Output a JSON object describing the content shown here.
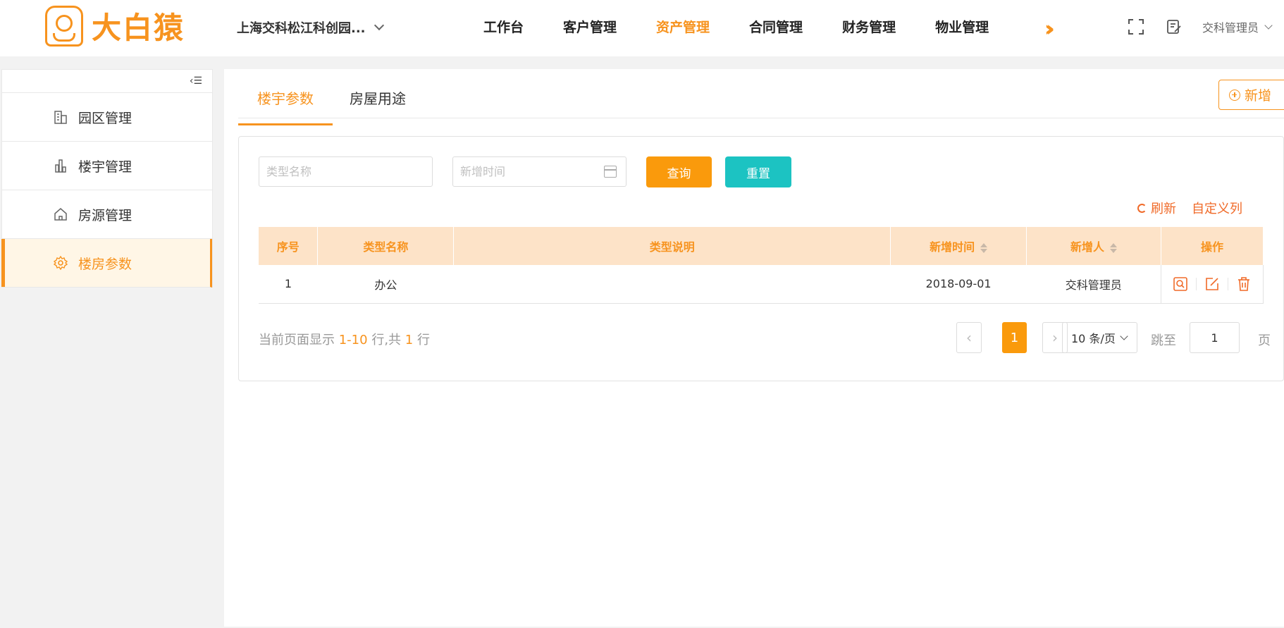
{
  "header": {
    "logo_text": "大白猿",
    "park_name": "上海交科松江科创园...",
    "nav": [
      "工作台",
      "客户管理",
      "资产管理",
      "合同管理",
      "财务管理",
      "物业管理"
    ],
    "active_nav": "资产管理",
    "more_icon": "double-chevron-right-icon",
    "user": "交科管理员"
  },
  "sidebar": {
    "collapse_icon": "collapse-menu-icon",
    "items": [
      {
        "label": "园区管理",
        "icon": "building-icon"
      },
      {
        "label": "楼宇管理",
        "icon": "bar-chart-icon"
      },
      {
        "label": "房源管理",
        "icon": "house-icon"
      },
      {
        "label": "楼房参数",
        "icon": "gear-icon"
      }
    ],
    "active": "楼房参数"
  },
  "tabs": {
    "items": [
      "楼宇参数",
      "房屋用途"
    ],
    "active": "楼宇参数",
    "add_label": "新增"
  },
  "filters": {
    "type_placeholder": "类型名称",
    "date_placeholder": "新增时间",
    "query_label": "查询",
    "reset_label": "重置"
  },
  "toolbar": {
    "refresh_label": "刷新",
    "columns_label": "自定义列"
  },
  "table": {
    "headers": [
      "序号",
      "类型名称",
      "类型说明",
      "新增时间",
      "新增人",
      "操作"
    ],
    "rows": [
      {
        "index": "1",
        "name": "办公",
        "desc": "",
        "date": "2018-09-01",
        "creator": "交科管理员"
      }
    ]
  },
  "pagination": {
    "info_prefix": "当前页面显示",
    "range": "1-10",
    "info_mid": "行,共",
    "total": "1",
    "info_suffix": "行",
    "prev": "‹",
    "current_page": "1",
    "next": "›",
    "page_size": "10 条/页",
    "jump_label": "跳至",
    "jump_value": "1",
    "page_label": "页"
  },
  "colors": {
    "accent": "#f7931e",
    "query_button": "#fa9a0c",
    "reset_button": "#1cc3c2",
    "table_header_bg": "#fde3c8",
    "link": "#f06a28"
  }
}
